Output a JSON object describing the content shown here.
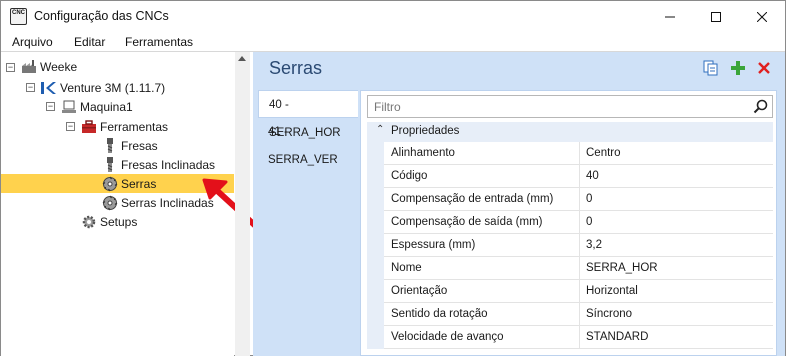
{
  "window": {
    "title": "Configuração das CNCs",
    "icon_text": "CNC"
  },
  "menu": [
    {
      "label": "Arquivo"
    },
    {
      "label": "Editar"
    },
    {
      "label": "Ferramentas"
    }
  ],
  "tree": {
    "nodes": [
      {
        "label": "Weeke",
        "icon": "factory-icon",
        "expander": "⊟"
      },
      {
        "label": "Venture 3M (1.11.7)",
        "icon": "machine-logo-icon",
        "expander": "⊟"
      },
      {
        "label": "Maquina1",
        "icon": "computer-icon",
        "expander": "⊟"
      },
      {
        "label": "Ferramentas",
        "icon": "toolbox-icon",
        "expander": "⊟"
      },
      {
        "label": "Fresas",
        "icon": "drill-bit-icon"
      },
      {
        "label": "Fresas Inclinadas",
        "icon": "drill-bit-icon"
      },
      {
        "label": "Serras",
        "icon": "saw-blade-icon",
        "selected": true
      },
      {
        "label": "Serras Inclinadas",
        "icon": "saw-blade-icon"
      },
      {
        "label": "Setups",
        "icon": "gear-icon"
      }
    ]
  },
  "panel": {
    "title": "Serras",
    "items": [
      {
        "label": "40 - SERRA_HOR",
        "active": true
      },
      {
        "label": "41 - SERRA_VER"
      }
    ],
    "search_placeholder": "Filtro",
    "category": "Propriedades",
    "properties": [
      {
        "name": "Alinhamento",
        "value": "Centro"
      },
      {
        "name": "Código",
        "value": "40"
      },
      {
        "name": "Compensação de entrada (mm)",
        "value": "0"
      },
      {
        "name": "Compensação de saída (mm)",
        "value": "0"
      },
      {
        "name": "Espessura (mm)",
        "value": "3,2"
      },
      {
        "name": "Nome",
        "value": "SERRA_HOR"
      },
      {
        "name": "Orientação",
        "value": "Horizontal"
      },
      {
        "name": "Sentido da rotação",
        "value": "Síncrono"
      },
      {
        "name": "Velocidade de avanço",
        "value": "STANDARD"
      }
    ]
  },
  "colors": {
    "selection": "#ffd24d",
    "panel_bg": "#cfe1f7",
    "title_text": "#2b4a73",
    "annotation_arrow": "#e3101a"
  }
}
